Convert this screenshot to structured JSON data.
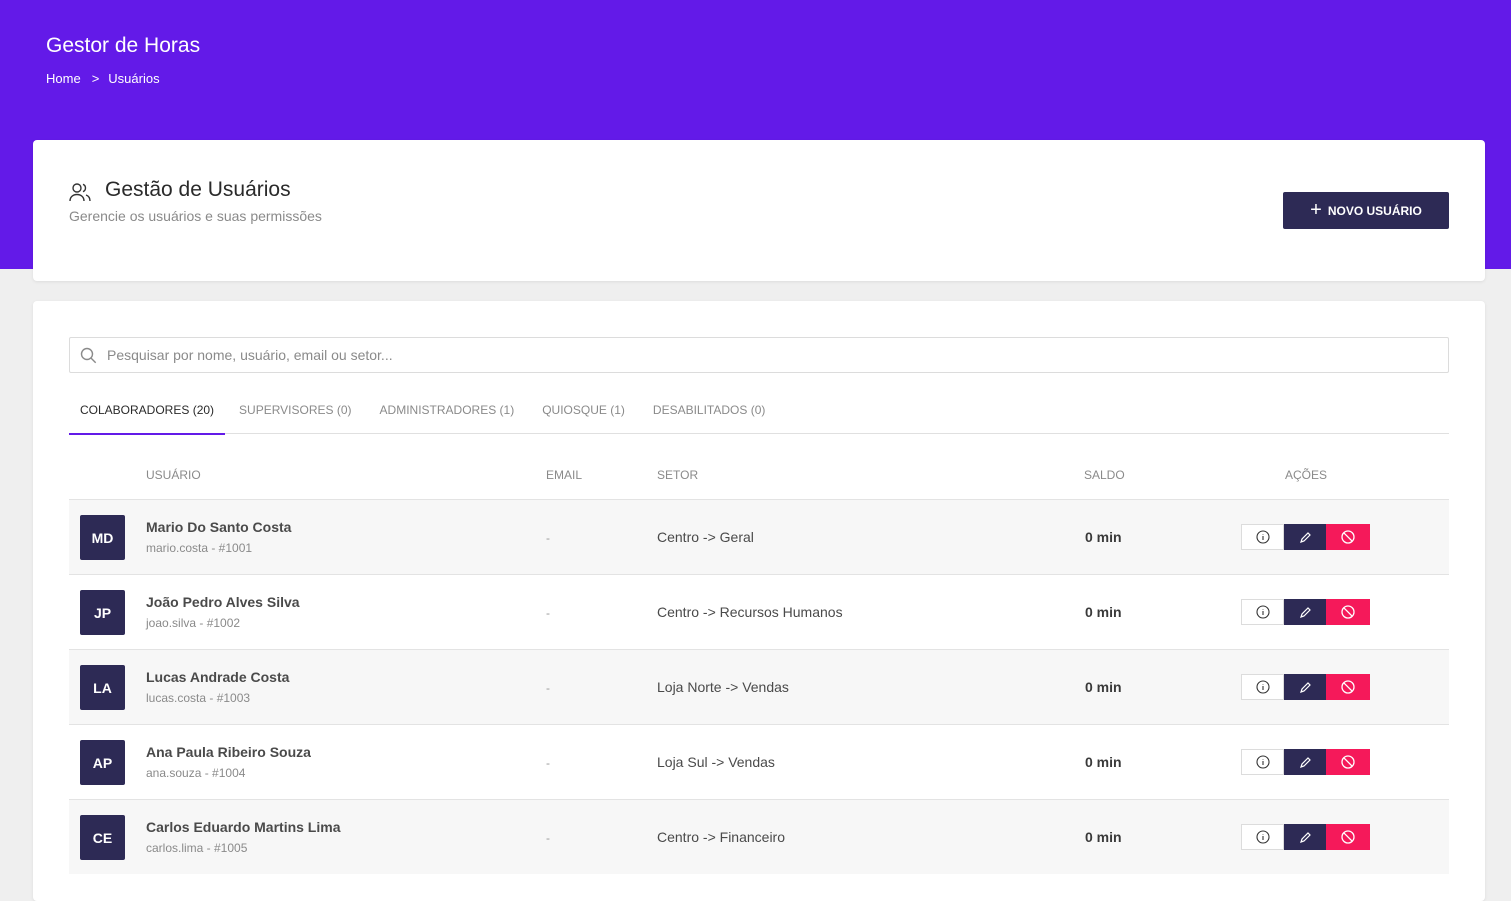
{
  "app": {
    "title": "Gestor de Horas"
  },
  "breadcrumb": {
    "home": "Home",
    "separator": ">",
    "current": "Usuários"
  },
  "header": {
    "title": "Gestão de Usuários",
    "subtitle": "Gerencie os usuários e suas permissões",
    "new_button_label": "NOVO USUÁRIO",
    "icon": "users-icon"
  },
  "search": {
    "placeholder": "Pesquisar por nome, usuário, email ou setor...",
    "value": ""
  },
  "tabs": [
    {
      "label": "COLABORADORES (20)",
      "active": true
    },
    {
      "label": "SUPERVISORES (0)",
      "active": false
    },
    {
      "label": "ADMINISTRADORES (1)",
      "active": false
    },
    {
      "label": "QUIOSQUE (1)",
      "active": false
    },
    {
      "label": "DESABILITADOS (0)",
      "active": false
    }
  ],
  "table": {
    "headers": {
      "user": "USUÁRIO",
      "email": "EMAIL",
      "sector": "SETOR",
      "balance": "SALDO",
      "actions": "AÇÕES"
    },
    "rows": [
      {
        "initials": "MD",
        "name": "Mario Do Santo Costa",
        "login": "mario.costa - #1001",
        "email": "-",
        "sector": "Centro -> Geral",
        "balance": "0 min"
      },
      {
        "initials": "JP",
        "name": "João Pedro Alves Silva",
        "login": "joao.silva - #1002",
        "email": "-",
        "sector": "Centro -> Recursos Humanos",
        "balance": "0 min"
      },
      {
        "initials": "LA",
        "name": "Lucas Andrade Costa",
        "login": "lucas.costa - #1003",
        "email": "-",
        "sector": "Loja Norte -> Vendas",
        "balance": "0 min"
      },
      {
        "initials": "AP",
        "name": "Ana Paula Ribeiro Souza",
        "login": "ana.souza - #1004",
        "email": "-",
        "sector": "Loja Sul -> Vendas",
        "balance": "0 min"
      },
      {
        "initials": "CE",
        "name": "Carlos Eduardo Martins Lima",
        "login": "carlos.lima - #1005",
        "email": "-",
        "sector": "Centro -> Financeiro",
        "balance": "0 min"
      }
    ]
  },
  "colors": {
    "brand": "#631ae8",
    "dark": "#2d2a55",
    "danger": "#f5195a",
    "background": "#efefef"
  }
}
